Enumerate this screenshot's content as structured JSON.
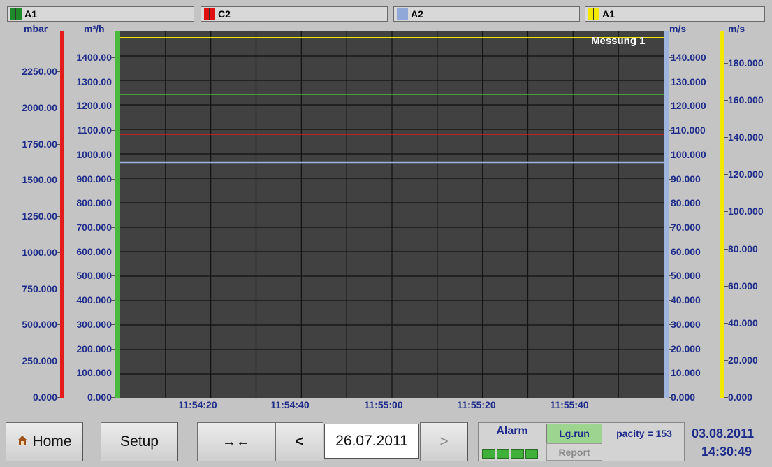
{
  "channels": [
    {
      "label": "A1",
      "color": "#1e8a2a"
    },
    {
      "label": "C2",
      "color": "#e01010"
    },
    {
      "label": "A2",
      "color": "#8fa8d8"
    },
    {
      "label": "A1",
      "color": "#f2e800"
    }
  ],
  "axes": {
    "left1": {
      "unit": "mbar",
      "color": "#e31b1b",
      "ticks": [
        "2250.00",
        "2000.00",
        "1750.00",
        "1500.00",
        "1250.00",
        "1000.00",
        "750.000",
        "500.000",
        "250.000",
        "0.000"
      ]
    },
    "left2": {
      "unit": "m³/h",
      "color": "#4aba3c",
      "ticks": [
        "1400.00",
        "1300.00",
        "1200.00",
        "1100.00",
        "1000.00",
        "900.000",
        "800.000",
        "700.000",
        "600.000",
        "500.000",
        "400.000",
        "300.000",
        "200.000",
        "100.000",
        "0.000"
      ]
    },
    "right1": {
      "unit": "m/s",
      "color": "#9fb4dc",
      "ticks": [
        "140.000",
        "130.000",
        "120.000",
        "110.000",
        "100.000",
        "90.000",
        "80.000",
        "70.000",
        "60.000",
        "50.000",
        "40.000",
        "30.000",
        "20.000",
        "10.000",
        "0.000"
      ]
    },
    "right2": {
      "unit": "m/s",
      "color": "#f2e800",
      "ticks": [
        "180.000",
        "160.000",
        "140.000",
        "120.000",
        "100.000",
        "80.000",
        "60.000",
        "40.000",
        "20.000",
        "0.000"
      ]
    }
  },
  "plot": {
    "label": "Messung 1",
    "background": "#414141"
  },
  "time_labels": [
    "11:54:20",
    "11:54:40",
    "11:55:00",
    "11:55:20",
    "11:55:40"
  ],
  "chart_data": {
    "type": "line",
    "x": [
      "11:54:20",
      "11:54:40",
      "11:55:00",
      "11:55:20",
      "11:55:40"
    ],
    "series": [
      {
        "color": "#f2e800",
        "axis": "m/s (right, 0-180)",
        "values": [
          177,
          177,
          177,
          177,
          177
        ]
      },
      {
        "color": "#4aba3c",
        "axis": "m³/h (0-1400)",
        "values": [
          1160,
          1160,
          1160,
          1160,
          1160
        ]
      },
      {
        "color": "#e31b1b",
        "axis": "mbar (0-2250)",
        "values": [
          1620,
          1620,
          1620,
          1620,
          1620
        ]
      },
      {
        "color": "#9fb4dc",
        "axis": "m/s (0-140)",
        "values": [
          90,
          90,
          90,
          90,
          90
        ]
      }
    ]
  },
  "toolbar": {
    "home": "Home",
    "setup": "Setup",
    "zoom": "→←",
    "prev": "<",
    "date": "26.07.2011",
    "next": ">",
    "alarm": "Alarm",
    "lgrun": "Lg.run",
    "report": "Report",
    "capacity": "pacity = 153",
    "cur_date": "03.08.2011",
    "cur_time": "14:30:49"
  }
}
